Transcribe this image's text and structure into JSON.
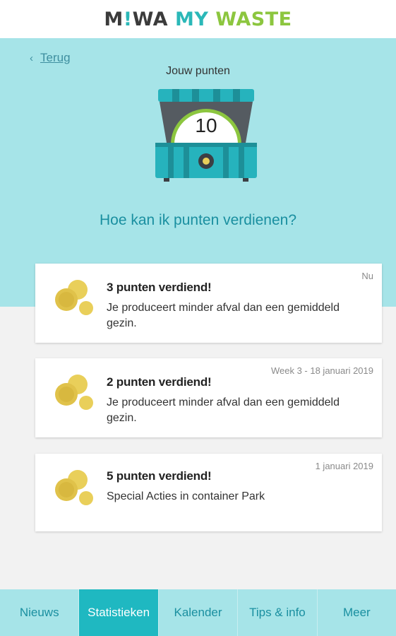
{
  "header": {
    "logo_miwa_a": "M",
    "logo_dot": "!",
    "logo_miwa_b": "WA",
    "logo_my": "MY",
    "logo_waste": "WASTE"
  },
  "hero": {
    "back_label": "Terug",
    "points_title": "Jouw punten",
    "points_value": "10",
    "how_title": "Hoe kan ik punten verdienen?"
  },
  "cards": [
    {
      "title": "3 punten verdiend!",
      "description": "Je produceert minder afval dan een gemiddeld gezin.",
      "time": "Nu",
      "icon": "coins-icon"
    },
    {
      "title": "2 punten verdiend!",
      "description": "Je produceert minder afval dan een gemiddeld gezin.",
      "time": "Week 3 - 18 januari 2019",
      "icon": "coins-icon"
    },
    {
      "title": "5 punten verdiend!",
      "description": "Special Acties in container Park",
      "time": "1 januari 2019",
      "icon": "coins-icon"
    }
  ],
  "tabs": [
    {
      "label": "Nieuws",
      "active": false
    },
    {
      "label": "Statistieken",
      "active": true
    },
    {
      "label": "Kalender",
      "active": false
    },
    {
      "label": "Tips & info",
      "active": false
    },
    {
      "label": "Meer",
      "active": false
    }
  ],
  "colors": {
    "hero_bg": "#a6e4e8",
    "accent": "#1fb8c1",
    "accent_text": "#1a8fa0",
    "brand_green": "#8cc63f",
    "coin": "#e9cf5a"
  }
}
